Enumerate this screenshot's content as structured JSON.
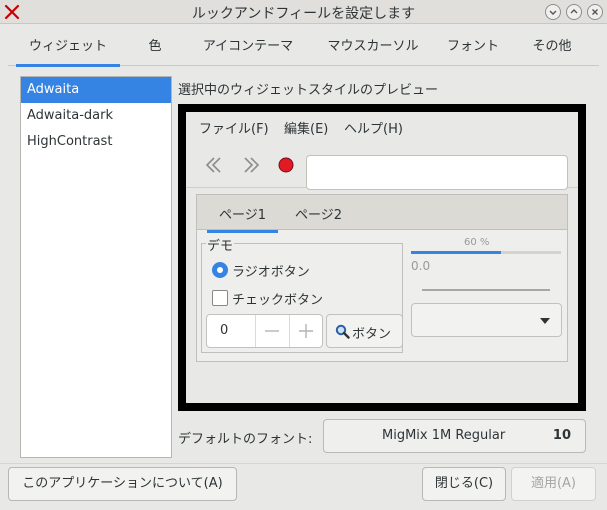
{
  "window": {
    "title": "ルックアンドフィールを設定します"
  },
  "tabs": [
    {
      "label": "ウィジェット",
      "active": true
    },
    {
      "label": "色"
    },
    {
      "label": "アイコンテーマ"
    },
    {
      "label": "マウスカーソル"
    },
    {
      "label": "フォント"
    },
    {
      "label": "その他"
    }
  ],
  "themes": {
    "items": [
      "Adwaita",
      "Adwaita-dark",
      "HighContrast"
    ],
    "selected": "Adwaita"
  },
  "preview": {
    "label": "選択中のウィジェットスタイルのプレビュー",
    "menu": [
      "ファイル(F)",
      "編集(E)",
      "ヘルプ(H)"
    ],
    "entry_value": "",
    "notebook_tabs": [
      "ページ1",
      "ページ2"
    ],
    "demo_frame_label": "デモ",
    "radio_label": "ラジオボタン",
    "radio_checked": true,
    "check_label": "チェックボタン",
    "check_checked": false,
    "spin_value": "0",
    "button_label": "ボタン",
    "progress_text": "60 %",
    "progress_fraction": 0.6,
    "scale_value": "0.0",
    "combo_value": ""
  },
  "font": {
    "label": "デフォルトのフォント:",
    "name": "MigMix 1M Regular",
    "size": "10"
  },
  "buttons": {
    "about": "このアプリケーションについて(A)",
    "close": "閉じる(C)",
    "apply": "適用(A)"
  },
  "colors": {
    "accent": "#3584e4",
    "record": "#e01b24",
    "close_x": "#cc0000"
  }
}
